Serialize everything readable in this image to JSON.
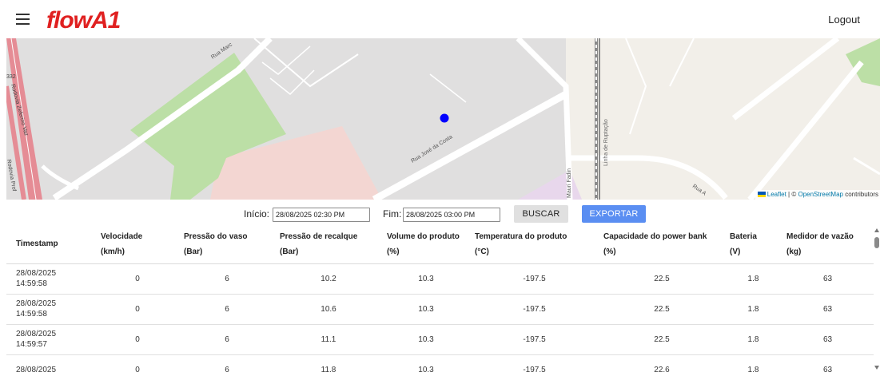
{
  "header": {
    "logo_text": "flowA1",
    "menu_icon": "hamburger-icon",
    "logout_label": "Logout"
  },
  "map": {
    "streets": {
      "rua_marco": "Rua Marc",
      "rua_jose_da_costa": "Rua José da Costa",
      "rodovia_prof": "Rodovia Prof",
      "rodovia_zeferino_vaz": "Rodovia Zeferino Vaz",
      "route_number": "332",
      "linha_ferrea": "Linha de Ruptação",
      "rua_fadin": "Mauri Fadin",
      "rua_a": "Rua A"
    },
    "attribution": {
      "leaflet": "Leaflet",
      "separator": "| ©",
      "osm": "OpenStreetMap",
      "contributors": "contributors"
    },
    "colors": {
      "marker": "#0000ff",
      "park": "#bcdfa6",
      "highway": "#e58c95",
      "zone": "#f0d5d0"
    }
  },
  "filters": {
    "start_label": "Início:",
    "start_value": "28/08/2025 02:30 PM",
    "end_label": "Fim:",
    "end_value": "28/08/2025 03:00 PM",
    "search_label": "BUSCAR",
    "export_label": "EXPORTAR"
  },
  "table": {
    "headers": [
      [
        "Timestamp",
        ""
      ],
      [
        "Velocidade",
        "(km/h)"
      ],
      [
        "Pressão do vaso",
        "(Bar)"
      ],
      [
        "Pressão de recalque",
        "(Bar)"
      ],
      [
        "Volume do produto",
        "(%)"
      ],
      [
        "Temperatura do produto",
        "(°C)"
      ],
      [
        "Capacidade do power bank",
        "(%)"
      ],
      [
        "Bateria",
        "(V)"
      ],
      [
        "Medidor de vazão",
        "(kg)"
      ]
    ],
    "rows": [
      {
        "date": "28/08/2025",
        "time": "14:59:58",
        "cells": [
          "0",
          "6",
          "10.2",
          "10.3",
          "-197.5",
          "22.5",
          "1.8",
          "63"
        ]
      },
      {
        "date": "28/08/2025",
        "time": "14:59:58",
        "cells": [
          "0",
          "6",
          "10.6",
          "10.3",
          "-197.5",
          "22.5",
          "1.8",
          "63"
        ]
      },
      {
        "date": "28/08/2025",
        "time": "14:59:57",
        "cells": [
          "0",
          "6",
          "11.1",
          "10.3",
          "-197.5",
          "22.5",
          "1.8",
          "63"
        ]
      },
      {
        "date": "28/08/2025",
        "time": "",
        "cells": [
          "0",
          "6",
          "11.8",
          "10.3",
          "-197.5",
          "22.6",
          "1.8",
          "63"
        ]
      }
    ]
  }
}
